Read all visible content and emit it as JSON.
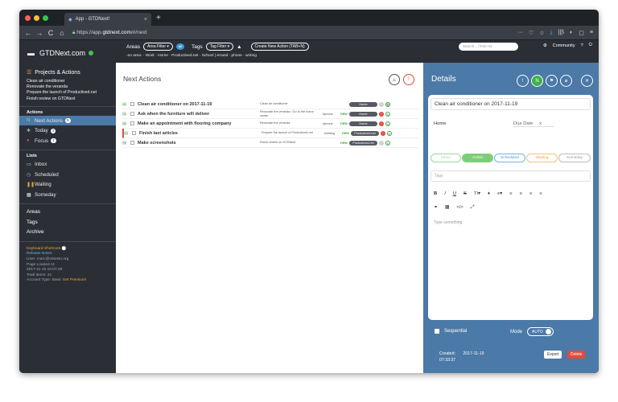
{
  "browser": {
    "tab_title": "App - GTDNext!",
    "tab_close": "×",
    "new_tab": "+",
    "url_prefix": "https://app.",
    "url_domain": "gtdnext.com",
    "url_path": "/#/next",
    "nav": [
      "←",
      "→",
      "C",
      "⌂"
    ],
    "right_icons": [
      "···",
      "♡",
      "☆",
      "⤓",
      "|||\\",
      "◐",
      "▢",
      "≡"
    ]
  },
  "sidebar": {
    "logo": "GTDNext.com",
    "projects_header": "Projects & Actions",
    "projects": [
      "Clean air conditioner",
      "Renovate the veranda",
      "Prepare the launch of Productived.net",
      "Finish review on GTDNext"
    ],
    "actions_label": "Actions",
    "actions": [
      {
        "label": "Next Actions",
        "count": "5"
      },
      {
        "label": "Today",
        "count": "2"
      },
      {
        "label": "Focus",
        "count": "1"
      }
    ],
    "lists_label": "Lists",
    "lists": [
      {
        "label": "Inbox"
      },
      {
        "label": "Scheduled"
      },
      {
        "label": "Waiting"
      },
      {
        "label": "Someday"
      }
    ],
    "bottom": [
      "Areas",
      "Tags",
      "Archive"
    ],
    "keyboard_shortcuts": "Keyboard Shortcuts",
    "release_notes": "Release Notes",
    "user": "User: marc@mbesto.org",
    "page_loaded_label": "Page Loaded At:",
    "page_loaded": "2017-11-19 16:07:28",
    "total_items": "Total Items: 21",
    "account_type": "Account Type: Basic",
    "get_premium": "Get Premium!"
  },
  "topbar": {
    "areas_label": "Areas",
    "area_filter": "Area Filter ▾",
    "plus": "⇄",
    "tags_label": "Tags",
    "tag_filter": "Tag Filter ▾",
    "caret": "▲",
    "create_action": "Create New Action (TAB+N)",
    "areas_list": "-no area-  ·  Work  ·  Home  ·  Productived.net  ·  School   |   errand  ·  phone  ·  writing",
    "search_placeholder": "Search... (TAB+S)",
    "community": "Community",
    "help": "?",
    "logout": "⏻"
  },
  "main": {
    "title": "Next Actions",
    "rows": [
      {
        "name": "Clean air conditioner on 2017-11-19",
        "note": "Clean air conditioner",
        "tag": "",
        "new": "",
        "context": "Home",
        "status": "#cfcfcf",
        "status2": "#cfcfcf"
      },
      {
        "name": "Ask when the furniture will deliver",
        "note": "Renovate the veranda / Go to the home center",
        "tag": "#phone",
        "new": "new",
        "context": "Home",
        "status": "#e24a3c",
        "status2": "#ffffff"
      },
      {
        "name": "Make an appointment with flooring company",
        "note": "Renovate the veranda",
        "tag": "#phone",
        "new": "new",
        "context": "Home",
        "status": "#e24a3c",
        "status2": "#ffffff"
      },
      {
        "name": "Finish last articles",
        "note": "Prepare the launch of Productived.net",
        "tag": "#writing",
        "new": "new",
        "context": "Productived.net",
        "status": "#e24a3c",
        "status2": "#ffffff"
      },
      {
        "name": "Make screenshots",
        "note": "Finish review on GTDNext",
        "tag": "",
        "new": "new",
        "context": "Productived.net",
        "status": "#cfcfcf",
        "status2": "#ffffff"
      }
    ]
  },
  "details": {
    "title": "Details",
    "task_name": "Clean air conditioner on 2017-11-19",
    "area": "Home",
    "due_date": "Due Date",
    "due_clear": "x",
    "statuses": [
      "Inbox",
      "Active",
      "Scheduled",
      "Waiting",
      "Someday"
    ],
    "tags_placeholder": "Tags",
    "toolbar": [
      "B",
      "I",
      "U",
      "S",
      "TI▾",
      "♦",
      "≡▾",
      "≡",
      "≡",
      "≡",
      "≡"
    ],
    "toolbar2": [
      "⚭",
      "▦",
      "</>",
      "⤢"
    ],
    "editor_placeholder": "Type something",
    "sequential": "Sequential",
    "mode_label": "Mode",
    "mode_value": "AUTO",
    "created_label": "Created:",
    "created_date": "2017-11-19",
    "created_time": "07:33:37",
    "export": "Export",
    "delete": "Delete",
    "icons": [
      "!",
      "N",
      "⚑",
      "⌀",
      "✕"
    ]
  }
}
